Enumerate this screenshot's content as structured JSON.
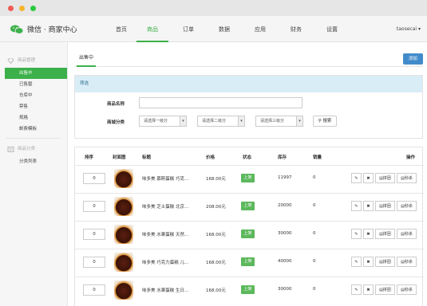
{
  "window": {
    "dots": {
      "close": "#f25b55",
      "minimize": "#f7b52b",
      "maximize": "#2cc840"
    }
  },
  "header": {
    "logo_text": "微信 · 商家中心",
    "nav": [
      {
        "label": "首页"
      },
      {
        "label": "商品"
      },
      {
        "label": "订单"
      },
      {
        "label": "数据"
      },
      {
        "label": "应用"
      },
      {
        "label": "财务"
      },
      {
        "label": "设置"
      }
    ],
    "active_nav": "商品",
    "user": "taosecai ▾"
  },
  "sidebar": {
    "group1": "商品管理",
    "items": [
      {
        "label": "出售中"
      },
      {
        "label": "已售罄"
      },
      {
        "label": "仓库中"
      },
      {
        "label": "禁售"
      },
      {
        "label": "规格"
      },
      {
        "label": "邮费模板"
      }
    ],
    "group2": "商品分类",
    "items2": [
      {
        "label": "分类列表"
      }
    ]
  },
  "main": {
    "tab": "出售中",
    "add_button": "添加",
    "filter": {
      "title": "筛选",
      "name_label": "商品名称",
      "name_value": "",
      "category_label": "商城分类",
      "select1": "请选择一级分",
      "select2": "请选择二级分",
      "select3": "请选择三级分",
      "search_button": "搜索"
    },
    "table": {
      "headers": {
        "sort": "排序",
        "cover": "封面图",
        "title": "标题",
        "price": "价格",
        "status": "状态",
        "stock": "库存",
        "sales": "销量",
        "ops": "操作"
      },
      "actions": {
        "edit": "",
        "delete": "",
        "group": "拼团",
        "seckill": "秒杀"
      },
      "rows": [
        {
          "sort": "0",
          "title": "味多美 慕斯蛋糕 巧克…",
          "price": "168.00元",
          "status": "上架",
          "stock": "11997",
          "sales": "0"
        },
        {
          "sort": "0",
          "title": "味多美 芝士蛋糕 北京…",
          "price": "208.00元",
          "status": "上架",
          "stock": "20000",
          "sales": "0"
        },
        {
          "sort": "0",
          "title": "味多美 水果蛋糕 天然…",
          "price": "168.00元",
          "status": "上架",
          "stock": "30000",
          "sales": "0"
        },
        {
          "sort": "0",
          "title": "味多美 巧克力蛋糕 儿…",
          "price": "168.00元",
          "status": "上架",
          "stock": "40000",
          "sales": "0"
        },
        {
          "sort": "0",
          "title": "味多美 水果蛋糕 生日…",
          "price": "168.00元",
          "status": "上架",
          "stock": "30000",
          "sales": "0"
        }
      ]
    }
  }
}
